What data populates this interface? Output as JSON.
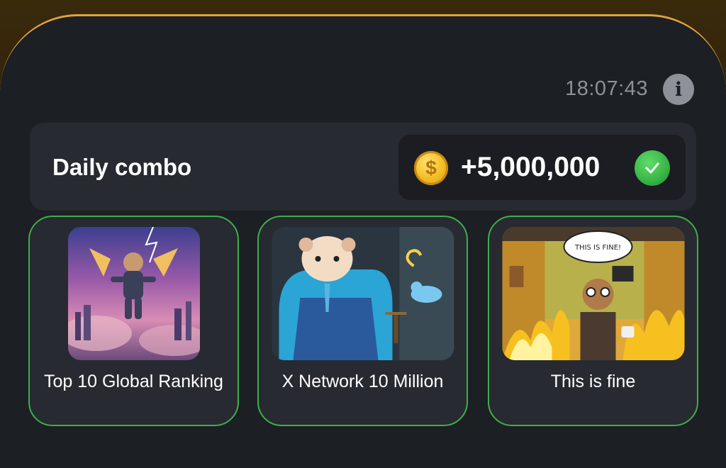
{
  "header": {
    "timer": "18:07:43",
    "info_icon": "info-icon"
  },
  "combo": {
    "title": "Daily combo",
    "reward": "+5,000,000",
    "coin_icon": "coin-icon",
    "status_icon": "check-icon"
  },
  "cards": [
    {
      "label": "Top 10 Global Ranking"
    },
    {
      "label": "X Network 10 Million"
    },
    {
      "label": "This is fine",
      "speech": "THIS IS FINE!"
    }
  ],
  "colors": {
    "accent_gold": "#e0a43c",
    "card_border": "#3fae4a",
    "panel_bg": "#1c1f24"
  }
}
